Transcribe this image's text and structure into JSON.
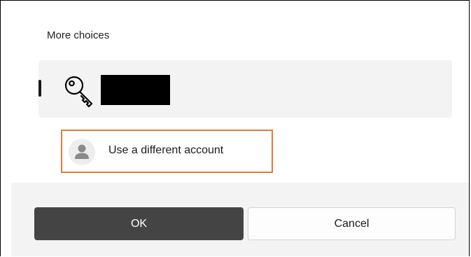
{
  "dialog": {
    "more_choices_label": "More choices",
    "account_tile_icon": "key-icon",
    "alt_account": {
      "label": "Use a different account",
      "icon": "person-icon"
    },
    "buttons": {
      "ok_label": "OK",
      "cancel_label": "Cancel"
    }
  },
  "colors": {
    "highlight_outline": "#e07b39",
    "primary_button": "#444444",
    "tile_background": "#f3f3f3"
  }
}
